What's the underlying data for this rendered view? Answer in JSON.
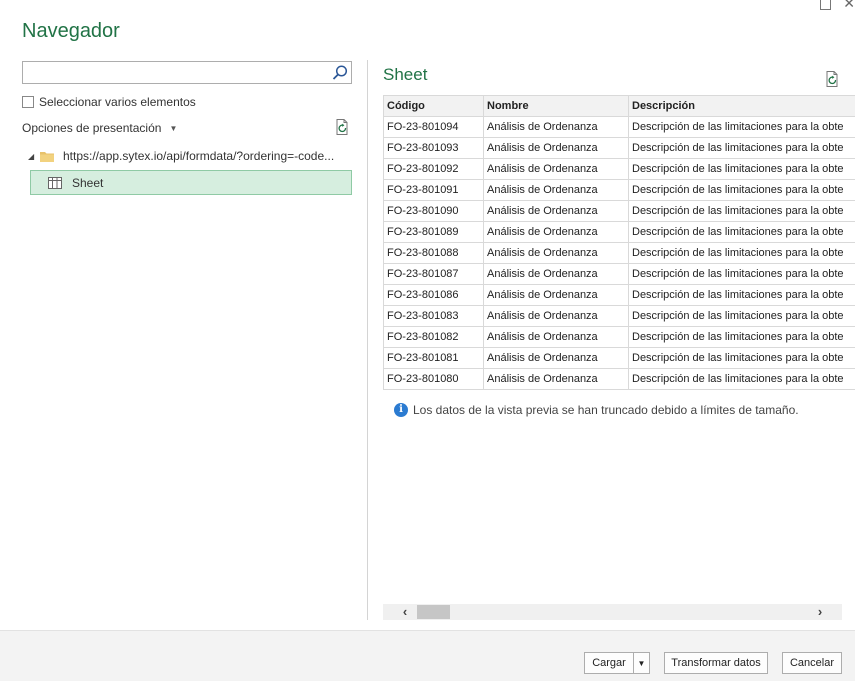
{
  "window": {
    "title": "Navegador"
  },
  "left": {
    "search": {
      "value": "",
      "placeholder": ""
    },
    "multi_select_label": "Seleccionar varios elementos",
    "display_options_label": "Opciones de presentación",
    "tree": {
      "root_label": "https://app.sytex.io/api/formdata/?ordering=-code...",
      "items": [
        {
          "label": "Sheet",
          "selected": true
        }
      ]
    }
  },
  "preview": {
    "title": "Sheet",
    "columns": [
      "Código",
      "Nombre",
      "Descripción"
    ],
    "rows": [
      [
        "FO-23-801094",
        "Análisis de Ordenanza",
        "Descripción de las limitaciones para la obte"
      ],
      [
        "FO-23-801093",
        "Análisis de Ordenanza",
        "Descripción de las limitaciones para la obte"
      ],
      [
        "FO-23-801092",
        "Análisis de Ordenanza",
        "Descripción de las limitaciones para la obte"
      ],
      [
        "FO-23-801091",
        "Análisis de Ordenanza",
        "Descripción de las limitaciones para la obte"
      ],
      [
        "FO-23-801090",
        "Análisis de Ordenanza",
        "Descripción de las limitaciones para la obte"
      ],
      [
        "FO-23-801089",
        "Análisis de Ordenanza",
        "Descripción de las limitaciones para la obte"
      ],
      [
        "FO-23-801088",
        "Análisis de Ordenanza",
        "Descripción de las limitaciones para la obte"
      ],
      [
        "FO-23-801087",
        "Análisis de Ordenanza",
        "Descripción de las limitaciones para la obte"
      ],
      [
        "FO-23-801086",
        "Análisis de Ordenanza",
        "Descripción de las limitaciones para la obte"
      ],
      [
        "FO-23-801083",
        "Análisis de Ordenanza",
        "Descripción de las limitaciones para la obte"
      ],
      [
        "FO-23-801082",
        "Análisis de Ordenanza",
        "Descripción de las limitaciones para la obte"
      ],
      [
        "FO-23-801081",
        "Análisis de Ordenanza",
        "Descripción de las limitaciones para la obte"
      ],
      [
        "FO-23-801080",
        "Análisis de Ordenanza",
        "Descripción de las limitaciones para la obte"
      ]
    ],
    "info_text": "Los datos de la vista previa se han truncado debido a límites de tamaño."
  },
  "footer": {
    "load_label": "Cargar",
    "transform_label": "Transformar datos",
    "cancel_label": "Cancelar"
  },
  "colors": {
    "accent": "#217346",
    "selection_bg": "#d6eedf",
    "info_icon": "#2b7bd1"
  },
  "icons": [
    "search-icon",
    "refresh-icon",
    "folder-icon",
    "table-icon",
    "info-icon",
    "chevron-down-icon",
    "scroll-left-arrow-icon",
    "scroll-right-arrow-icon",
    "maximize-icon",
    "close-icon"
  ]
}
